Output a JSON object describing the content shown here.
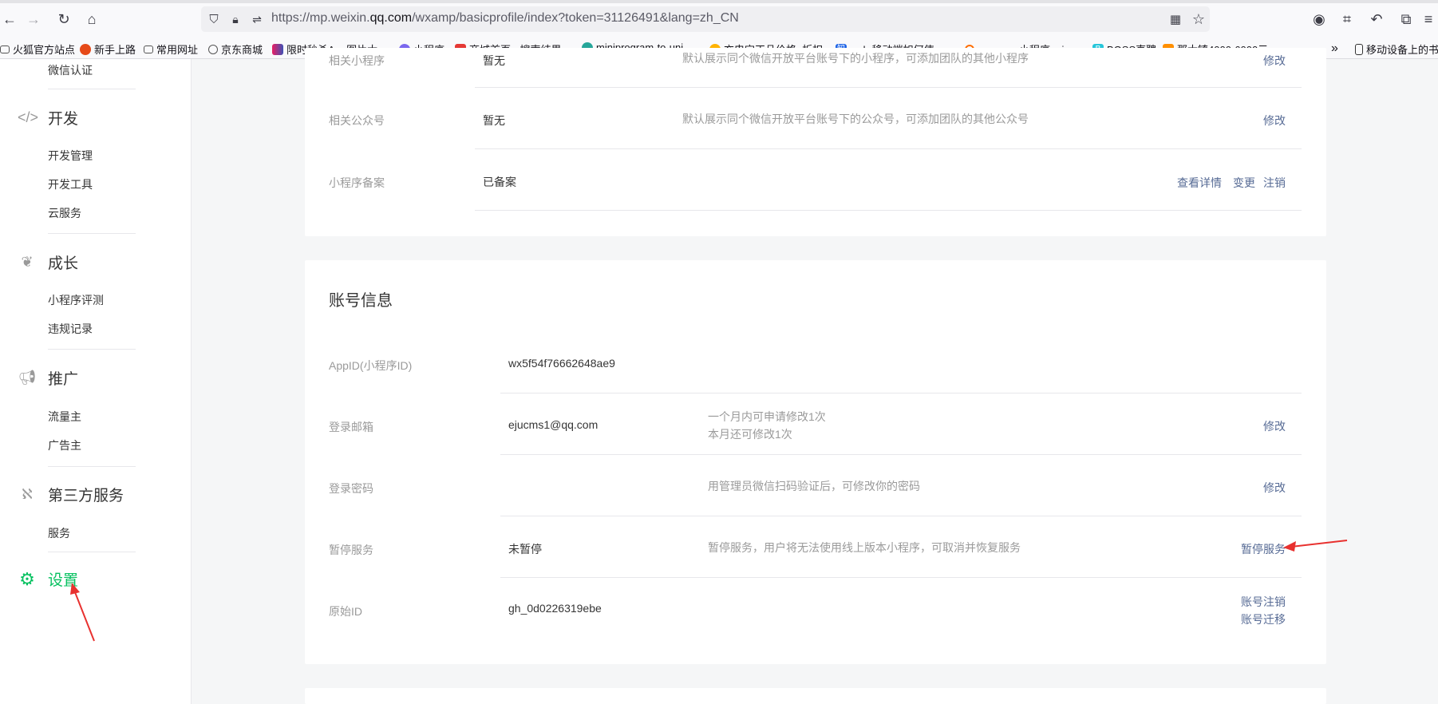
{
  "browser": {
    "url_prefix": "https://mp.weixin.",
    "url_domain": "qq.com",
    "url_suffix": "/wxamp/basicprofile/index?token=31126491&lang=zh_CN",
    "bookmarks": [
      "火狐官方站点",
      "新手上路",
      "常用网址",
      "京东商城",
      "限时秒杀App图片大...",
      "小程序",
      "商城首页 - 搜索结果 -...",
      "miniprogram-to-uni...",
      "充电宝正品价格_折扣...",
      "web 移动端如何使 px...",
      "eyoucms小程序api_e...",
      "BOSS直聘",
      "那大镇4000-6000元...",
      "移动设备上的书签"
    ]
  },
  "sidebar": {
    "top_item": "微信认证",
    "sections": [
      {
        "title": "开发",
        "icon": "code-icon",
        "items": [
          "开发管理",
          "开发工具",
          "云服务"
        ]
      },
      {
        "title": "成长",
        "icon": "sprout-icon",
        "items": [
          "小程序评测",
          "违规记录"
        ]
      },
      {
        "title": "推广",
        "icon": "megaphone-icon",
        "items": [
          "流量主",
          "广告主"
        ]
      },
      {
        "title": "第三方服务",
        "icon": "third-party-icon",
        "items": [
          "服务"
        ]
      },
      {
        "title": "设置",
        "icon": "gear-icon",
        "items": []
      }
    ]
  },
  "card1": {
    "rows": [
      {
        "label": "相关小程序",
        "value": "暂无",
        "desc": "默认展示同个微信开放平台账号下的小程序，可添加团队的其他小程序",
        "links": [
          "修改"
        ]
      },
      {
        "label": "相关公众号",
        "value": "暂无",
        "desc": "默认展示同个微信开放平台账号下的公众号，可添加团队的其他公众号",
        "links": [
          "修改"
        ]
      },
      {
        "label": "小程序备案",
        "value": "已备案",
        "desc": "",
        "links": [
          "查看详情",
          "变更",
          "注销"
        ]
      }
    ]
  },
  "account": {
    "title": "账号信息",
    "rows": [
      {
        "label": "AppID(小程序ID)",
        "value": "wx5f54f76662648ae9",
        "desc": "",
        "links": []
      },
      {
        "label": "登录邮箱",
        "value": "ejucms1@qq.com",
        "desc1": "一个月内可申请修改1次",
        "desc2": "本月还可修改1次",
        "links": [
          "修改"
        ]
      },
      {
        "label": "登录密码",
        "value": "",
        "desc": "用管理员微信扫码验证后，可修改你的密码",
        "links": [
          "修改"
        ]
      },
      {
        "label": "暂停服务",
        "value": "未暂停",
        "desc": "暂停服务，用户将无法使用线上版本小程序，可取消并恢复服务",
        "links": [
          "暂停服务"
        ]
      },
      {
        "label": "原始ID",
        "value": "gh_0d0226319ebe",
        "desc": "",
        "links": [
          "账号注销",
          "账号迁移"
        ]
      }
    ]
  },
  "colors": {
    "accent": "#07c160",
    "link": "#576b95",
    "annotation": "#e8312f"
  }
}
